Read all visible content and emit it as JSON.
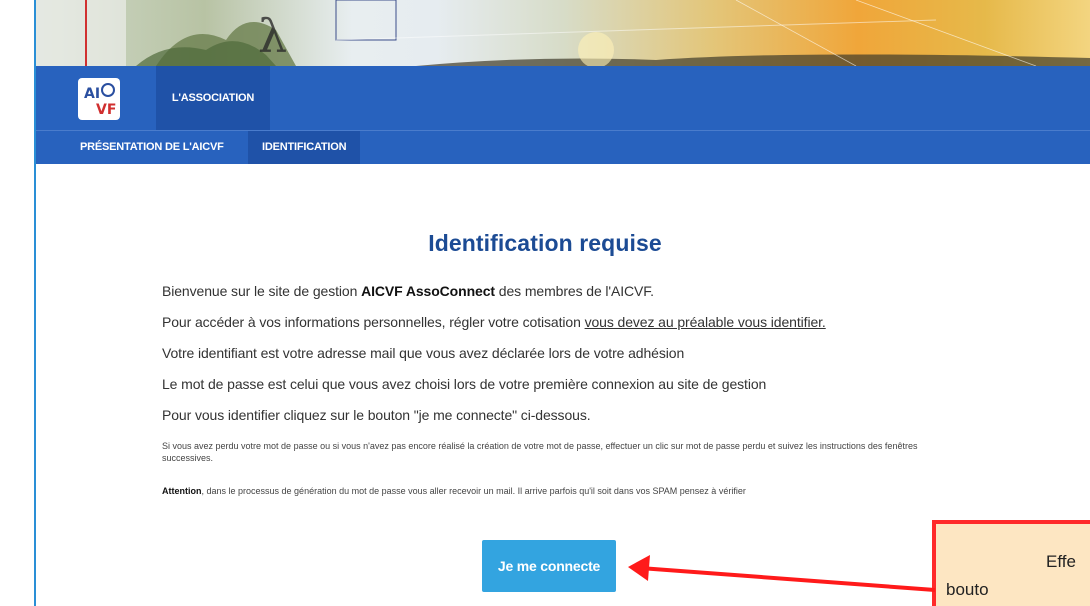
{
  "nav": {
    "primary": {
      "association_label": "L'ASSOCIATION"
    },
    "secondary": {
      "presentation_label": "PRÉSENTATION DE L'AICVF",
      "identification_label": "IDENTIFICATION"
    },
    "logo_text": "AICVF"
  },
  "main": {
    "title": "Identification requise",
    "p1_prefix": "Bienvenue sur le site de gestion ",
    "p1_strong": "AICVF AssoConnect",
    "p1_suffix": " des membres de l'AICVF.",
    "p2_prefix": "Pour accéder à vos informations personnelles, régler votre cotisation ",
    "p2_link": "vous devez au préalable vous identifier.",
    "p3": "Votre identifiant est votre adresse mail que vous avez déclarée lors de votre adhésion",
    "p4": "Le mot de passe est celui que vous avez choisi lors de votre première connexion au site de gestion",
    "p5": "Pour vous identifier cliquez sur le bouton \"je me connecte\" ci-dessous.",
    "small1": "Si vous avez perdu votre mot de passe ou si vous n'avez pas encore réalisé la création de votre mot de passe, effectuer un clic sur mot de passe perdu et suivez les instructions des fenêtres successives.",
    "small2_strong": "Attention",
    "small2_rest": ", dans le processus de génération du mot de passe vous aller recevoir un mail. Il arrive parfois qu'il soit dans vos SPAM pensez à vérifier",
    "connect_button": "Je me connecte"
  },
  "callout": {
    "line1": "Effe",
    "line2": "bouto"
  },
  "colors": {
    "nav_blue": "#2862be",
    "nav_active": "#1f52a8",
    "title_blue": "#1c4b94",
    "button_blue": "#33a4e0",
    "callout_red": "#ff2a2a",
    "callout_bg": "#fde6c2"
  }
}
